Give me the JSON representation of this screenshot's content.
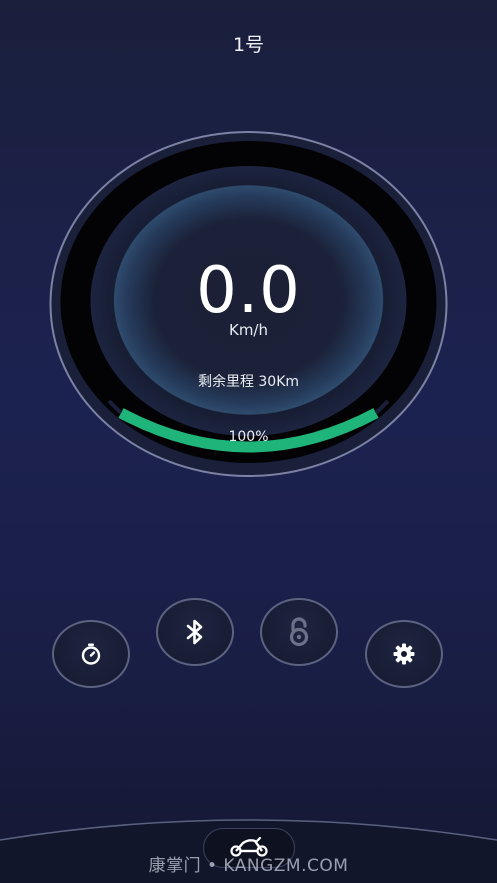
{
  "header": {
    "title": "1号"
  },
  "dashboard": {
    "speed": "0.0",
    "speed_unit": "Km/h",
    "range_text": "剩余里程 30Km",
    "battery_text": "100%",
    "battery_level": 1.0,
    "accent_color": "#1fb47a"
  },
  "controls": [
    {
      "name": "timer-button",
      "icon": "stopwatch-icon"
    },
    {
      "name": "bluetooth-button",
      "icon": "bluetooth-icon"
    },
    {
      "name": "lock-button",
      "icon": "unlock-icon"
    },
    {
      "name": "settings-button",
      "icon": "gear-icon"
    }
  ],
  "nav": {
    "center_icon": "scooter-icon"
  },
  "watermark": "康掌门 • KANGZM.COM"
}
